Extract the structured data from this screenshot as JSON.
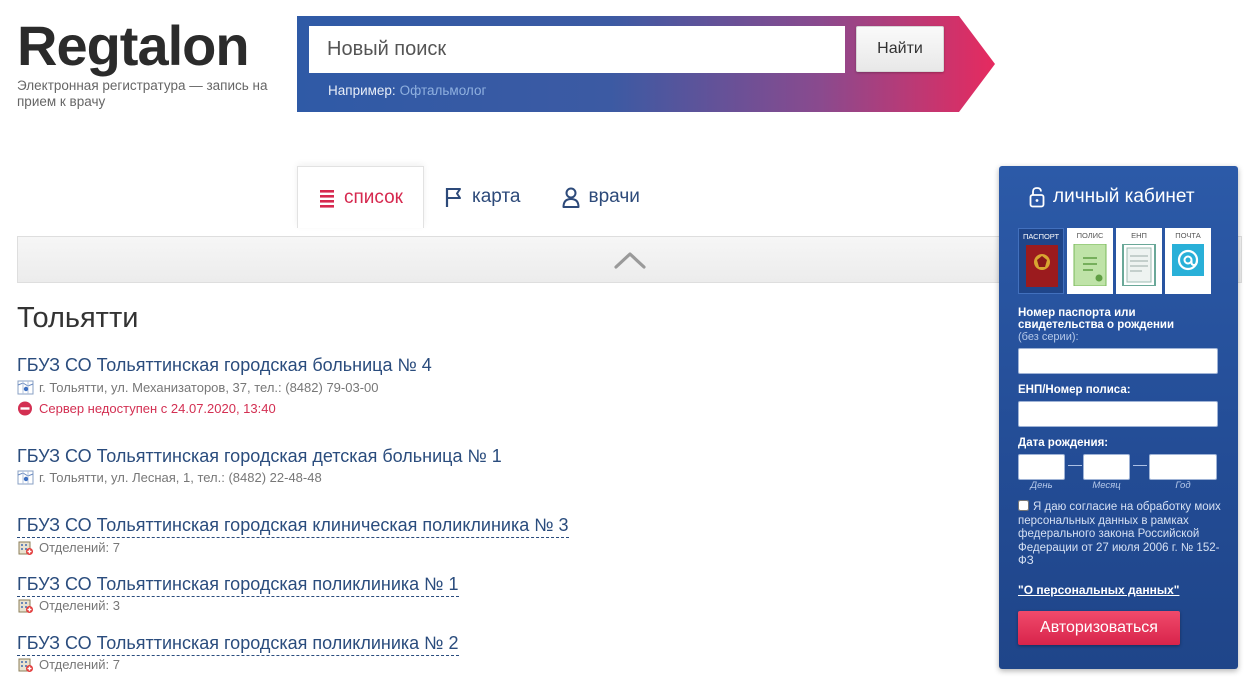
{
  "header": {
    "logo": "Regtalon",
    "tagline": "Электронная регистратура — запись на прием к врачу"
  },
  "search": {
    "placeholder": "Новый поиск",
    "button": "Найти",
    "example_label": "Например:",
    "example_link": "Офтальмолог"
  },
  "tabs": [
    {
      "label": "список",
      "icon": "list-icon",
      "active": true
    },
    {
      "label": "карта",
      "icon": "flag-icon",
      "active": false
    },
    {
      "label": "врачи",
      "icon": "person-icon",
      "active": false
    }
  ],
  "city": "Тольятти",
  "clinics": [
    {
      "title": "ГБУЗ СО Тольяттинская городская больница № 4",
      "meta": "г. Тольятти, ул. Механизаторов, 37, тел.: (8482) 79-03-00",
      "error": "Сервер недоступен с 24.07.2020, 13:40"
    },
    {
      "title": "ГБУЗ СО Тольяттинская городская детская больница № 1",
      "meta": "г. Тольятти, ул. Лесная, 1, тел.: (8482) 22-48-48"
    },
    {
      "title": "ГБУЗ СО Тольяттинская городская клиническая поликлиника № 3",
      "meta": "Отделений: 7"
    },
    {
      "title": "ГБУЗ СО Тольяттинская городская поликлиника № 1",
      "meta": "Отделений: 3"
    },
    {
      "title": "ГБУЗ СО Тольяттинская городская поликлиника № 2",
      "meta": "Отделений: 7"
    }
  ],
  "cabinet": {
    "title": "личный кабинет",
    "docs": [
      {
        "label": "ПАСПОРТ",
        "active": true
      },
      {
        "label": "ПОЛИС",
        "active": false
      },
      {
        "label": "ЕНП",
        "active": false
      },
      {
        "label": "ПОЧТА",
        "active": false
      }
    ],
    "passport_label": "Номер паспорта или свидетельства о рождении",
    "passport_hint": "(без серии):",
    "policy_label": "ЕНП/Номер полиса:",
    "dob_label": "Дата рождения:",
    "dob_day": "День",
    "dob_month": "Месяц",
    "dob_year": "Год",
    "consent": "Я даю согласие на обработку моих персональных данных в рамках федерального закона Российской Федерации от 27 июля 2006 г. № 152-ФЗ",
    "pd_link": "\"О персональных данных\"",
    "auth_button": "Авторизоваться"
  },
  "colors": {
    "brand_blue": "#2a4c7d",
    "accent_red": "#d6294f",
    "panel_blue": "#2c5aa8"
  }
}
